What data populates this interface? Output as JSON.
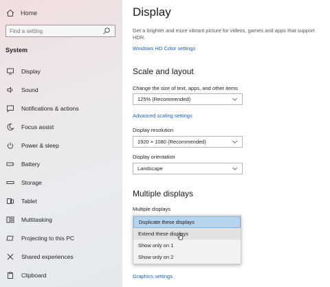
{
  "sidebar": {
    "home_label": "Home",
    "search": {
      "placeholder": "Find a setting"
    },
    "section_title": "System",
    "items": [
      {
        "label": "Display",
        "icon": "monitor-icon"
      },
      {
        "label": "Sound",
        "icon": "speaker-icon"
      },
      {
        "label": "Notifications & actions",
        "icon": "notification-icon"
      },
      {
        "label": "Focus assist",
        "icon": "moon-icon"
      },
      {
        "label": "Power & sleep",
        "icon": "power-icon"
      },
      {
        "label": "Battery",
        "icon": "battery-icon"
      },
      {
        "label": "Storage",
        "icon": "storage-icon"
      },
      {
        "label": "Tablet",
        "icon": "tablet-icon"
      },
      {
        "label": "Multitasking",
        "icon": "multitasking-icon"
      },
      {
        "label": "Projecting to this PC",
        "icon": "projecting-icon"
      },
      {
        "label": "Shared experiences",
        "icon": "shared-experiences-icon"
      },
      {
        "label": "Clipboard",
        "icon": "clipboard-icon"
      }
    ]
  },
  "main": {
    "title": "Display",
    "description": "Get a brighter and more vibrant picture for videos, games and apps that support HDR.",
    "hdr_link": "Windows HD Color settings",
    "scale_heading": "Scale and layout",
    "scale_label": "Change the size of text, apps, and other items",
    "scale_value": "125% (Recommended)",
    "advanced_scaling_link": "Advanced scaling settings",
    "resolution_label": "Display resolution",
    "resolution_value": "1920 × 1080 (Recommended)",
    "orientation_label": "Display orientation",
    "orientation_value": "Landscape",
    "multi_heading": "Multiple displays",
    "multi_label": "Multiple displays",
    "multi_options": [
      "Duplicate these displays",
      "Extend these displays",
      "Show only on 1",
      "Show only on 2"
    ],
    "graphics_link": "Graphics settings"
  },
  "colors": {
    "accent": "#1a62b5",
    "selected_option": "#b8d3ee"
  }
}
